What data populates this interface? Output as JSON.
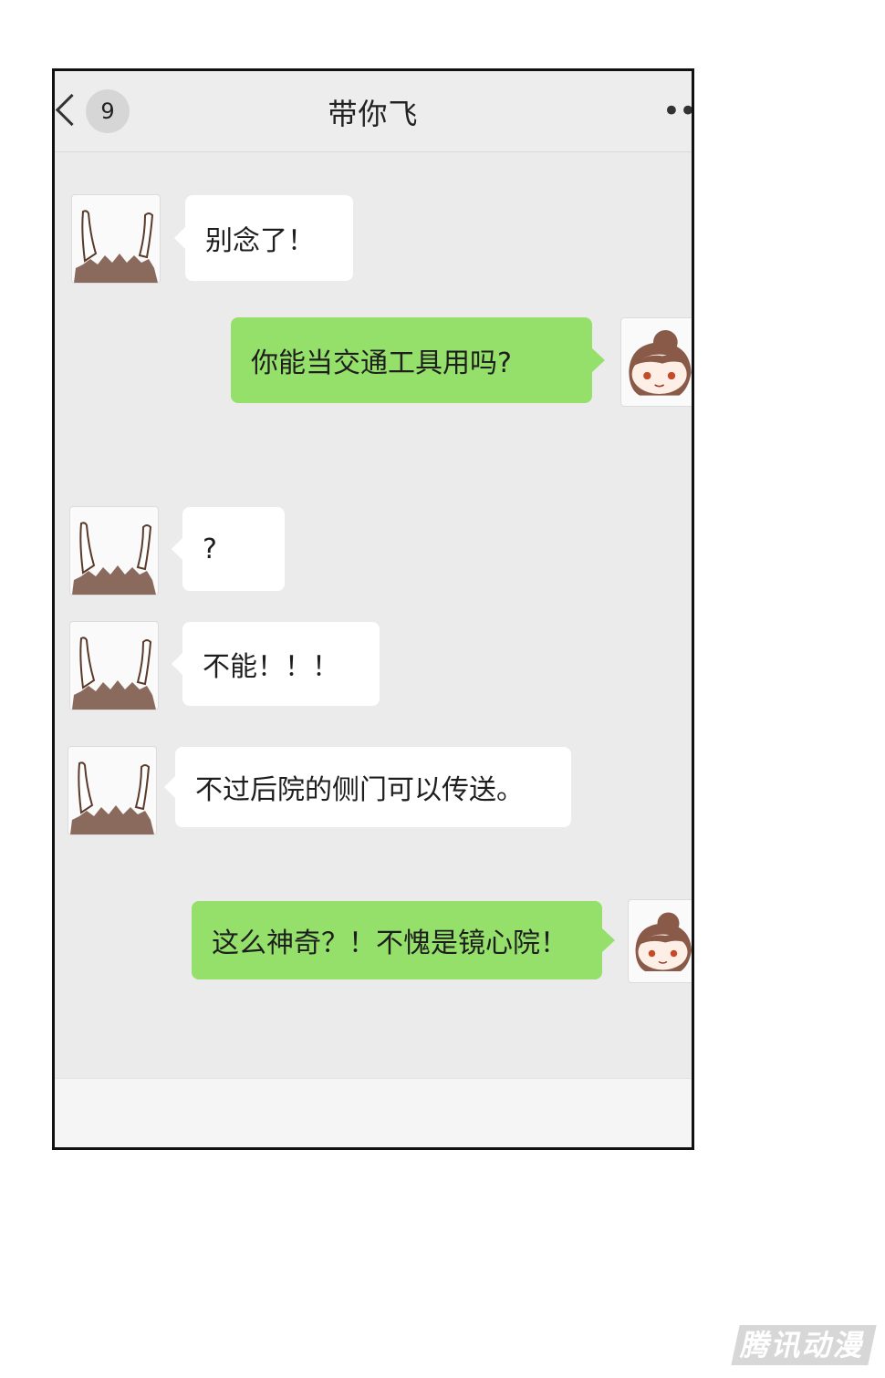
{
  "header": {
    "back_icon": "chevron-left-icon",
    "unread_count": "9",
    "title": "带你飞",
    "more_icon": "more-dots-icon"
  },
  "messages": [
    {
      "sender": "other",
      "text": "别念了！"
    },
    {
      "sender": "self",
      "text": "你能当交通工具用吗?"
    },
    {
      "sender": "other",
      "text": "?"
    },
    {
      "sender": "other",
      "text": "不能！！！"
    },
    {
      "sender": "other",
      "text": "不过后院的侧门可以传送。"
    },
    {
      "sender": "self",
      "text": "这么神奇？！不愧是镜心院！"
    }
  ],
  "colors": {
    "self_bubble": "#94e06a",
    "other_bubble": "#ffffff",
    "chat_background": "#ebebeb"
  },
  "watermark": {
    "text": "腾讯动漫"
  }
}
